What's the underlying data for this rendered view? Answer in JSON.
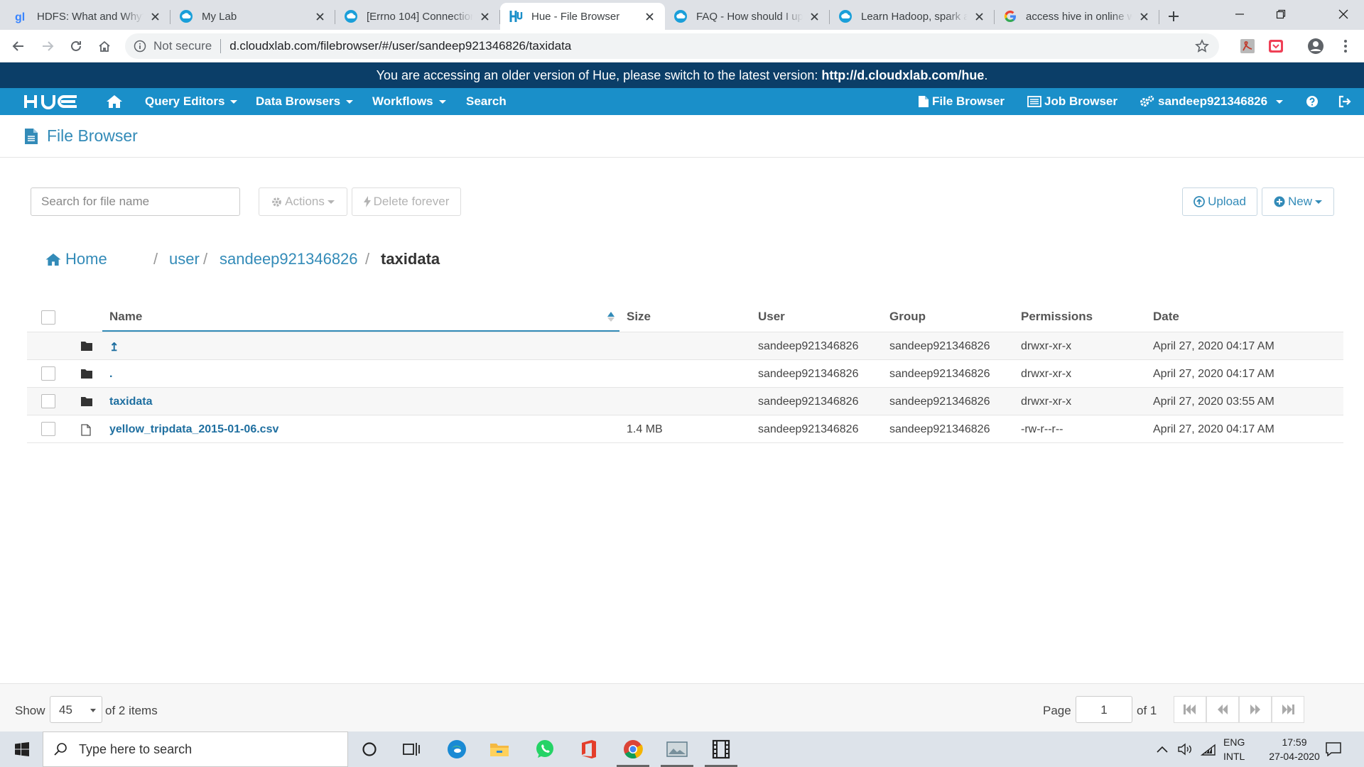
{
  "browser": {
    "tabs": [
      {
        "title": "HDFS: What and Why?",
        "icon": "gitbook-icon",
        "active": false
      },
      {
        "title": "My Lab",
        "icon": "cloudxlab-icon",
        "active": false
      },
      {
        "title": "[Errno 104] Connection reset",
        "icon": "cloudxlab-icon",
        "active": false
      },
      {
        "title": "Hue - File Browser",
        "icon": "hue-icon",
        "active": true
      },
      {
        "title": "FAQ - How should I upload",
        "icon": "cloudxlab-icon",
        "active": false
      },
      {
        "title": "Learn Hadoop, spark and",
        "icon": "cloudxlab-icon",
        "active": false
      },
      {
        "title": "access hive in online web",
        "icon": "google-icon",
        "active": false
      }
    ],
    "security_label": "Not secure",
    "url": "d.cloudxlab.com/filebrowser/#/user/sandeep921346826/taxidata"
  },
  "banner": {
    "text": "You are accessing an older version of Hue, please switch to the latest version: ",
    "link": "http://d.cloudxlab.com/hue",
    "suffix": "."
  },
  "hue_nav": {
    "logo": "HUE",
    "query_editors": "Query Editors",
    "data_browsers": "Data Browsers",
    "workflows": "Workflows",
    "search": "Search",
    "file_browser": "File Browser",
    "job_browser": "Job Browser",
    "user": "sandeep921346826"
  },
  "page": {
    "title": "File Browser"
  },
  "controls": {
    "search_placeholder": "Search for file name",
    "actions": "Actions",
    "delete_forever": "Delete forever",
    "upload": "Upload",
    "new": "New"
  },
  "breadcrumb": {
    "home": "Home",
    "parts": [
      "user",
      "sandeep921346826"
    ],
    "current": "taxidata"
  },
  "table": {
    "headers": {
      "name": "Name",
      "size": "Size",
      "user": "User",
      "group": "Group",
      "permissions": "Permissions",
      "date": "Date"
    },
    "rows": [
      {
        "type": "folder",
        "name": "↥",
        "size": "",
        "user": "sandeep921346826",
        "group": "sandeep921346826",
        "permissions": "drwxr-xr-x",
        "date": "April 27, 2020 04:17 AM"
      },
      {
        "type": "folder",
        "name": ".",
        "size": "",
        "user": "sandeep921346826",
        "group": "sandeep921346826",
        "permissions": "drwxr-xr-x",
        "date": "April 27, 2020 04:17 AM"
      },
      {
        "type": "folder",
        "name": "taxidata",
        "size": "",
        "user": "sandeep921346826",
        "group": "sandeep921346826",
        "permissions": "drwxr-xr-x",
        "date": "April 27, 2020 03:55 AM"
      },
      {
        "type": "file",
        "name": "yellow_tripdata_2015-01-06.csv",
        "size": "1.4 MB",
        "user": "sandeep921346826",
        "group": "sandeep921346826",
        "permissions": "-rw-r--r--",
        "date": "April 27, 2020 04:17 AM"
      }
    ]
  },
  "footer": {
    "show": "Show",
    "page_size": "45",
    "items": "of 2 items",
    "page": "Page",
    "page_value": "1",
    "of_pages": "of 1"
  },
  "taskbar": {
    "search_placeholder": "Type here to search",
    "lang1": "ENG",
    "lang2": "INTL",
    "time": "17:59",
    "date": "27-04-2020"
  },
  "colors": {
    "hue_nav": "#1a8fc9",
    "banner": "#0b3e68",
    "link": "#338bb8"
  }
}
